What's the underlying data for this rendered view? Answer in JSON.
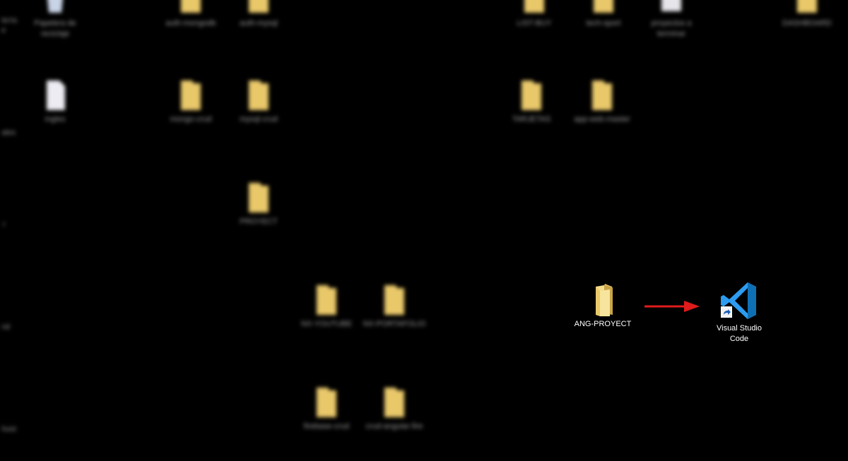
{
  "desktop": {
    "background": "#000000",
    "folder_color": "#e9c86a",
    "arrow_color": "#e01b1b",
    "blurred_icons": [
      {
        "label": "Papelera de reciclaje",
        "icon": "recycle-bin-icon"
      },
      {
        "label": "auth-mongodb",
        "icon": "folder-icon"
      },
      {
        "label": "auth-mysql",
        "icon": "folder-icon"
      },
      {
        "label": "LIST-BUY",
        "icon": "folder-icon"
      },
      {
        "label": "tech-sport",
        "icon": "folder-icon"
      },
      {
        "label": "proyectos a terminar",
        "icon": "document-icon"
      },
      {
        "label": "DASHBOARD",
        "icon": "folder-icon"
      },
      {
        "label": "ingles",
        "icon": "document-icon"
      },
      {
        "label": "mongo-crud",
        "icon": "folder-icon"
      },
      {
        "label": "mysql-crud",
        "icon": "folder-icon"
      },
      {
        "label": "TARJETAS",
        "icon": "folder-icon"
      },
      {
        "label": "app-web-master",
        "icon": "folder-icon"
      },
      {
        "label": "PROYECT",
        "icon": "folder-icon"
      },
      {
        "label": "NX-YOUTUBE",
        "icon": "folder-icon"
      },
      {
        "label": "NX-PORTAFOLIO",
        "icon": "folder-icon"
      },
      {
        "label": "firebase-crud",
        "icon": "folder-icon"
      },
      {
        "label": "crud-angular-fire",
        "icon": "folder-icon"
      }
    ],
    "edge_labels": [
      "tería\ne",
      "ales",
      "r",
      "ral",
      "host"
    ],
    "focus_icons": {
      "folder": {
        "label": "ANG-PROYECT",
        "icon": "folder-icon"
      },
      "vscode": {
        "label": "Visual Studio Code",
        "icon": "vscode-icon",
        "shortcut_overlay": "shortcut-arrow-icon"
      }
    },
    "annotation": {
      "icon": "red-arrow-icon"
    }
  }
}
